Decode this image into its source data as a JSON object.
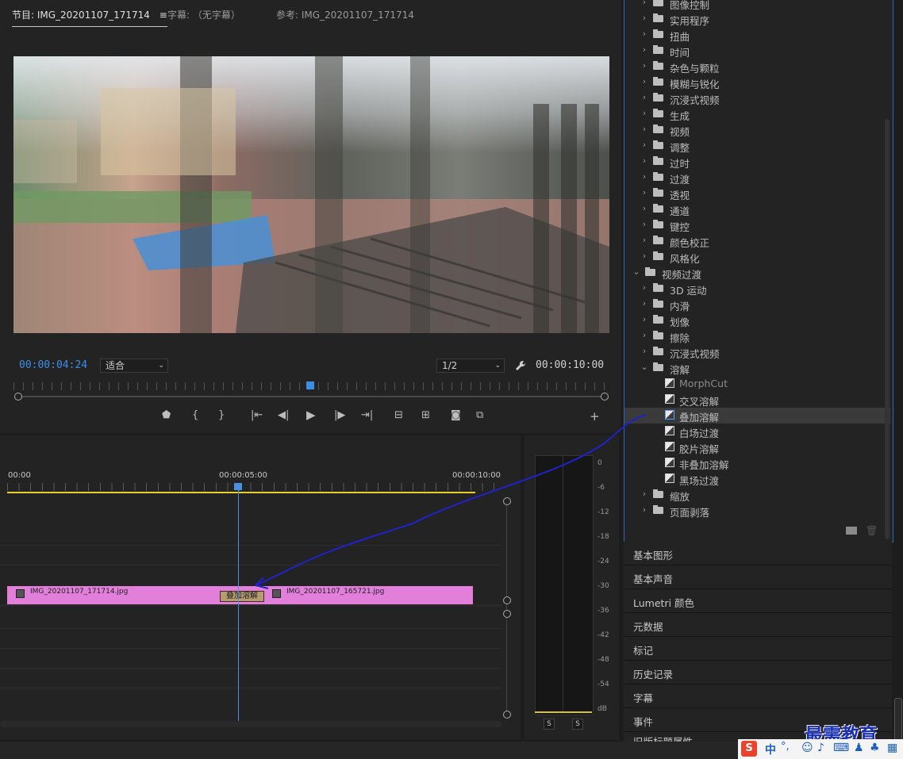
{
  "monitor": {
    "tabs": [
      "节目: IMG_20201107_171714",
      "字幕: （无字幕）",
      "参考: IMG_20201107_171714"
    ],
    "tab_menu_icon": "hamburger-icon",
    "current_time": "00:00:04:24",
    "fit": "适合",
    "resolution": "1/2",
    "duration": "00:00:10:00",
    "playhead_fraction": 0.49
  },
  "timeline": {
    "ruler": [
      "00:00",
      "00:00:05:00",
      "00:00:10:00"
    ],
    "clip_a": "IMG_20201107_171714.jpg",
    "clip_b": "IMG_20201107_165721.jpg",
    "transition": "叠加溶解",
    "accent": "#e27fdb",
    "playhead_color": "#4a8fe0"
  },
  "meters": {
    "ticks": [
      "0",
      "-6",
      "-12",
      "-18",
      "-24",
      "-30",
      "-36",
      "-42",
      "-48",
      "-54",
      "dB"
    ],
    "solo": [
      "S",
      "S"
    ]
  },
  "effects": {
    "top_cut": "图像控制",
    "folders_a": [
      "实用程序",
      "扭曲",
      "时间",
      "杂色与颗粒",
      "模糊与锐化",
      "沉浸式视频",
      "生成",
      "视频",
      "调整",
      "过时",
      "过渡",
      "透视",
      "通道",
      "键控",
      "颜色校正",
      "风格化"
    ],
    "video_transitions": "视频过渡",
    "folders_b": [
      "3D 运动",
      "内滑",
      "划像",
      "擦除",
      "沉浸式视频"
    ],
    "dissolve": "溶解",
    "dissolve_items": [
      "MorphCut",
      "交叉溶解",
      "叠加溶解",
      "白场过渡",
      "胶片溶解",
      "非叠加溶解",
      "黑场过渡"
    ],
    "selected": "叠加溶解",
    "folders_c": [
      "缩放",
      "页面剥落"
    ]
  },
  "panels": [
    "基本图形",
    "基本声音",
    "Lumetri 颜色",
    "元数据",
    "标记",
    "历史记录",
    "字幕",
    "事件"
  ],
  "panel_cut": "旧版标题属性",
  "watermark": "最需教育",
  "ime": [
    "中",
    "°,"
  ],
  "accent_color": "#2d6ab5"
}
